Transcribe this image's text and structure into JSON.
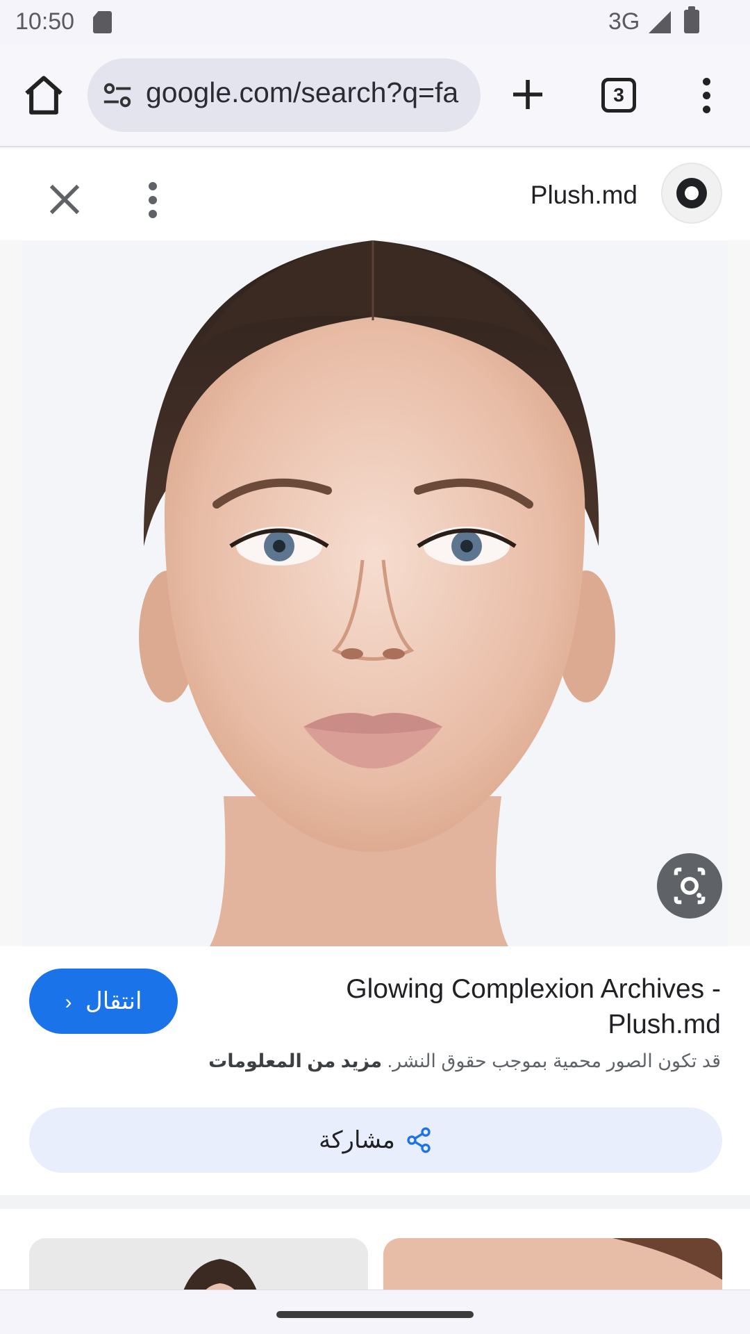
{
  "status_bar": {
    "time": "10:50",
    "network": "3G",
    "icons": [
      "sd-card-icon",
      "signal-icon",
      "battery-icon"
    ]
  },
  "browser": {
    "url": "google.com/search?q=fa",
    "tab_count": "3",
    "icons": [
      "home-icon",
      "site-settings-icon",
      "plus-icon",
      "tabs-icon",
      "more-vert-icon"
    ]
  },
  "viewer": {
    "source_name": "Plush.md",
    "icons": [
      "close-icon",
      "more-vert-icon",
      "source-avatar-icon",
      "lens-icon"
    ]
  },
  "result": {
    "title": "Glowing Complexion Archives - Plush.md",
    "visit_label": "انتقال",
    "copyright_notice": "قد تكون الصور محمية بموجب حقوق النشر.",
    "learn_more": "مزيد من المعلومات",
    "share_label": "مشاركة"
  },
  "colors": {
    "accent": "#1a73e8",
    "share_bg": "#e8eefb"
  }
}
